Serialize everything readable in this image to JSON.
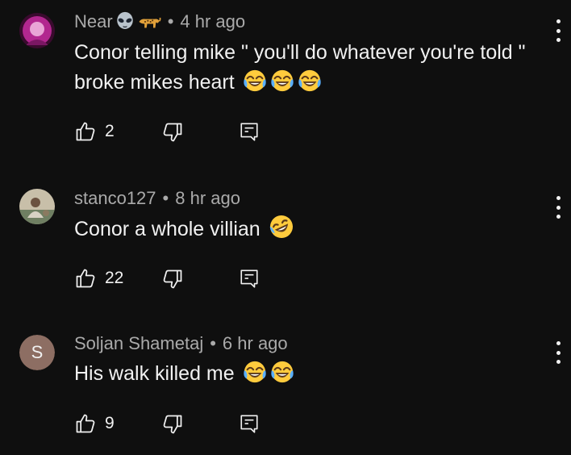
{
  "comments": [
    {
      "author": "Near",
      "author_emojis": [
        "alien-emoji",
        "leopard-emoji"
      ],
      "separator": "•",
      "time": "4 hr ago",
      "text": "Conor telling mike \" you'll do whatever you're told \" broke mikes heart",
      "text_emojis": [
        "face-with-tears-of-joy",
        "face-with-tears-of-joy",
        "face-with-tears-of-joy"
      ],
      "likes": "2",
      "avatar": {
        "type": "image",
        "colors": [
          "#3a0a2e",
          "#b2278f"
        ]
      }
    },
    {
      "author": "stanco127",
      "separator": "•",
      "time": "8 hr ago",
      "text": "Conor a whole villian",
      "text_emojis": [
        "rolling-on-the-floor-laughing"
      ],
      "likes": "22",
      "avatar": {
        "type": "image",
        "colors": [
          "#6f7f62",
          "#c8bfa9"
        ]
      }
    },
    {
      "author": "Soljan Shametaj",
      "separator": "•",
      "time": "6 hr ago",
      "text": "His walk killed me",
      "text_emojis": [
        "face-with-tears-of-joy",
        "face-with-tears-of-joy"
      ],
      "likes": "9",
      "avatar": {
        "type": "letter",
        "letter": "S",
        "color": "#8d6e63"
      }
    }
  ],
  "icons": {
    "like": "thumbs-up-icon",
    "dislike": "thumbs-down-icon",
    "reply": "reply-comment-icon",
    "more": "more-vertical-icon"
  },
  "colors": {
    "background": "#0f0f0f",
    "primary_text": "#f1f1f1",
    "secondary_text": "#aaaaaa"
  }
}
